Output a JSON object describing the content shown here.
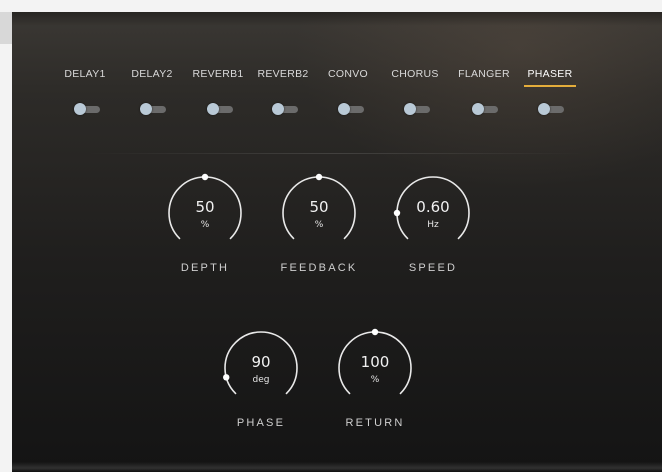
{
  "tabs": [
    {
      "label": "DELAY1",
      "active": false
    },
    {
      "label": "DELAY2",
      "active": false
    },
    {
      "label": "REVERB1",
      "active": false
    },
    {
      "label": "REVERB2",
      "active": false
    },
    {
      "label": "CONVO",
      "active": false
    },
    {
      "label": "CHORUS",
      "active": false
    },
    {
      "label": "FLANGER",
      "active": false
    },
    {
      "label": "PHASER",
      "active": true
    }
  ],
  "knobs": [
    {
      "label": "DEPTH",
      "value": "50",
      "unit": "%",
      "dot_angle": 0
    },
    {
      "label": "FEEDBACK",
      "value": "50",
      "unit": "%",
      "dot_angle": 0
    },
    {
      "label": "SPEED",
      "value": "0.60",
      "unit": "Hz",
      "dot_angle": -90
    },
    {
      "label": "PHASE",
      "value": "90",
      "unit": "deg",
      "dot_angle": -105
    },
    {
      "label": "RETURN",
      "value": "100",
      "unit": "%",
      "dot_angle": 0
    }
  ],
  "colors": {
    "accent": "#e4ad3b",
    "arc": "#e9e9e9",
    "toggle_knob": "#b9c9d6",
    "toggle_track": "#6b6b6b"
  }
}
